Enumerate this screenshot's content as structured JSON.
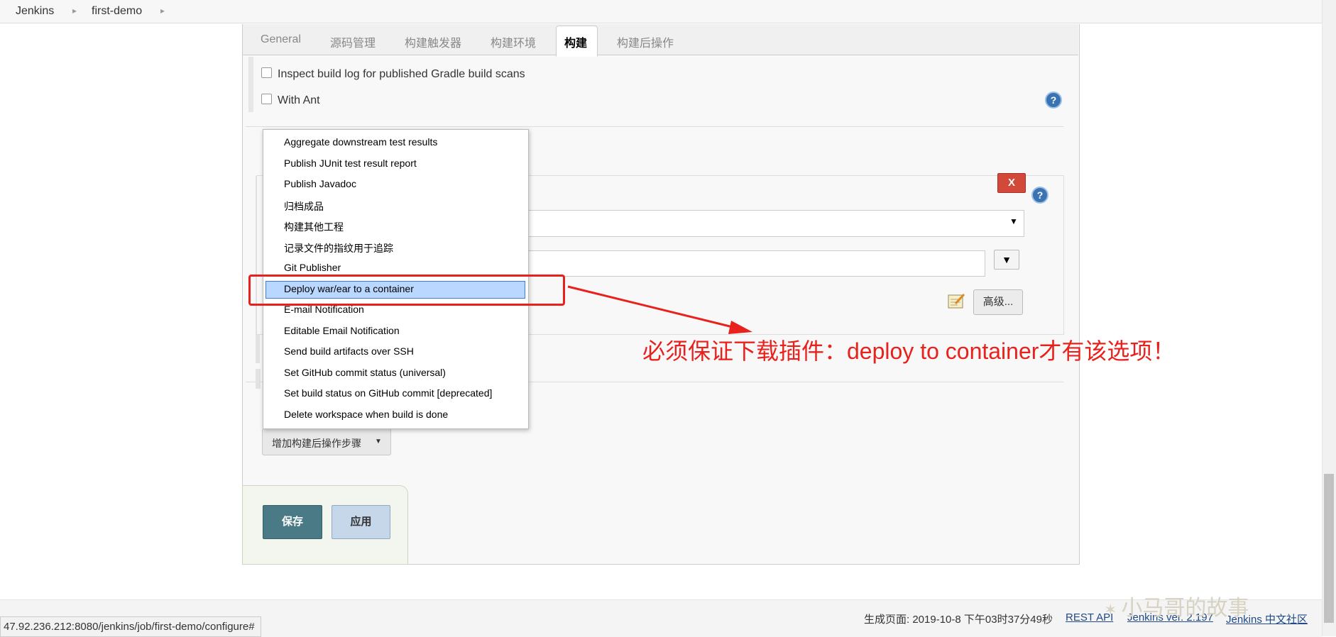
{
  "breadcrumb": {
    "items": [
      "Jenkins",
      "first-demo"
    ]
  },
  "tabs": [
    "General",
    "源码管理",
    "构建触发器",
    "构建环境",
    "构建",
    "构建后操作"
  ],
  "active_tab": "构建",
  "build_options": {
    "gradle_scan_label": "Inspect build log for published Gradle build scans",
    "with_ant_label": "With Ant"
  },
  "step": {
    "delete_label": "X",
    "select_arrow": "▼",
    "text_dropdown": "▼",
    "advanced_label": "高级..."
  },
  "add_post_build": {
    "label": "增加构建后操作步骤",
    "caret": "▼"
  },
  "actions": {
    "save_label": "保存",
    "apply_label": "应用"
  },
  "menu": {
    "items": [
      "Aggregate downstream test results",
      "Publish JUnit test result report",
      "Publish Javadoc",
      "归档成品",
      "构建其他工程",
      "记录文件的指纹用于追踪",
      "Git Publisher",
      "Deploy war/ear to a container",
      "E-mail Notification",
      "Editable Email Notification",
      "Send build artifacts over SSH",
      "Set GitHub commit status (universal)",
      "Set build status on GitHub commit [deprecated]",
      "Delete workspace when build is done"
    ],
    "selected": "Deploy war/ear to a container"
  },
  "annotation": {
    "text": "必须保证下载插件：deploy to container才有该选项！",
    "color": "#e8211c"
  },
  "footer": {
    "generated": "生成页面: 2019-10-8 下午03时37分49秒",
    "rest_api": "REST API",
    "version": "Jenkins ver. 2.197",
    "community": "Jenkins 中文社区"
  },
  "status_url": "47.92.236.212:8080/jenkins/job/first-demo/configure#",
  "watermark": "小马哥的故事",
  "colors": {
    "help_blue": "#3a73b3",
    "save_bg": "#4a7a86",
    "apply_bg": "#c7d7ea",
    "delete_red": "#d24939",
    "highlight": "#b9d7ff"
  }
}
